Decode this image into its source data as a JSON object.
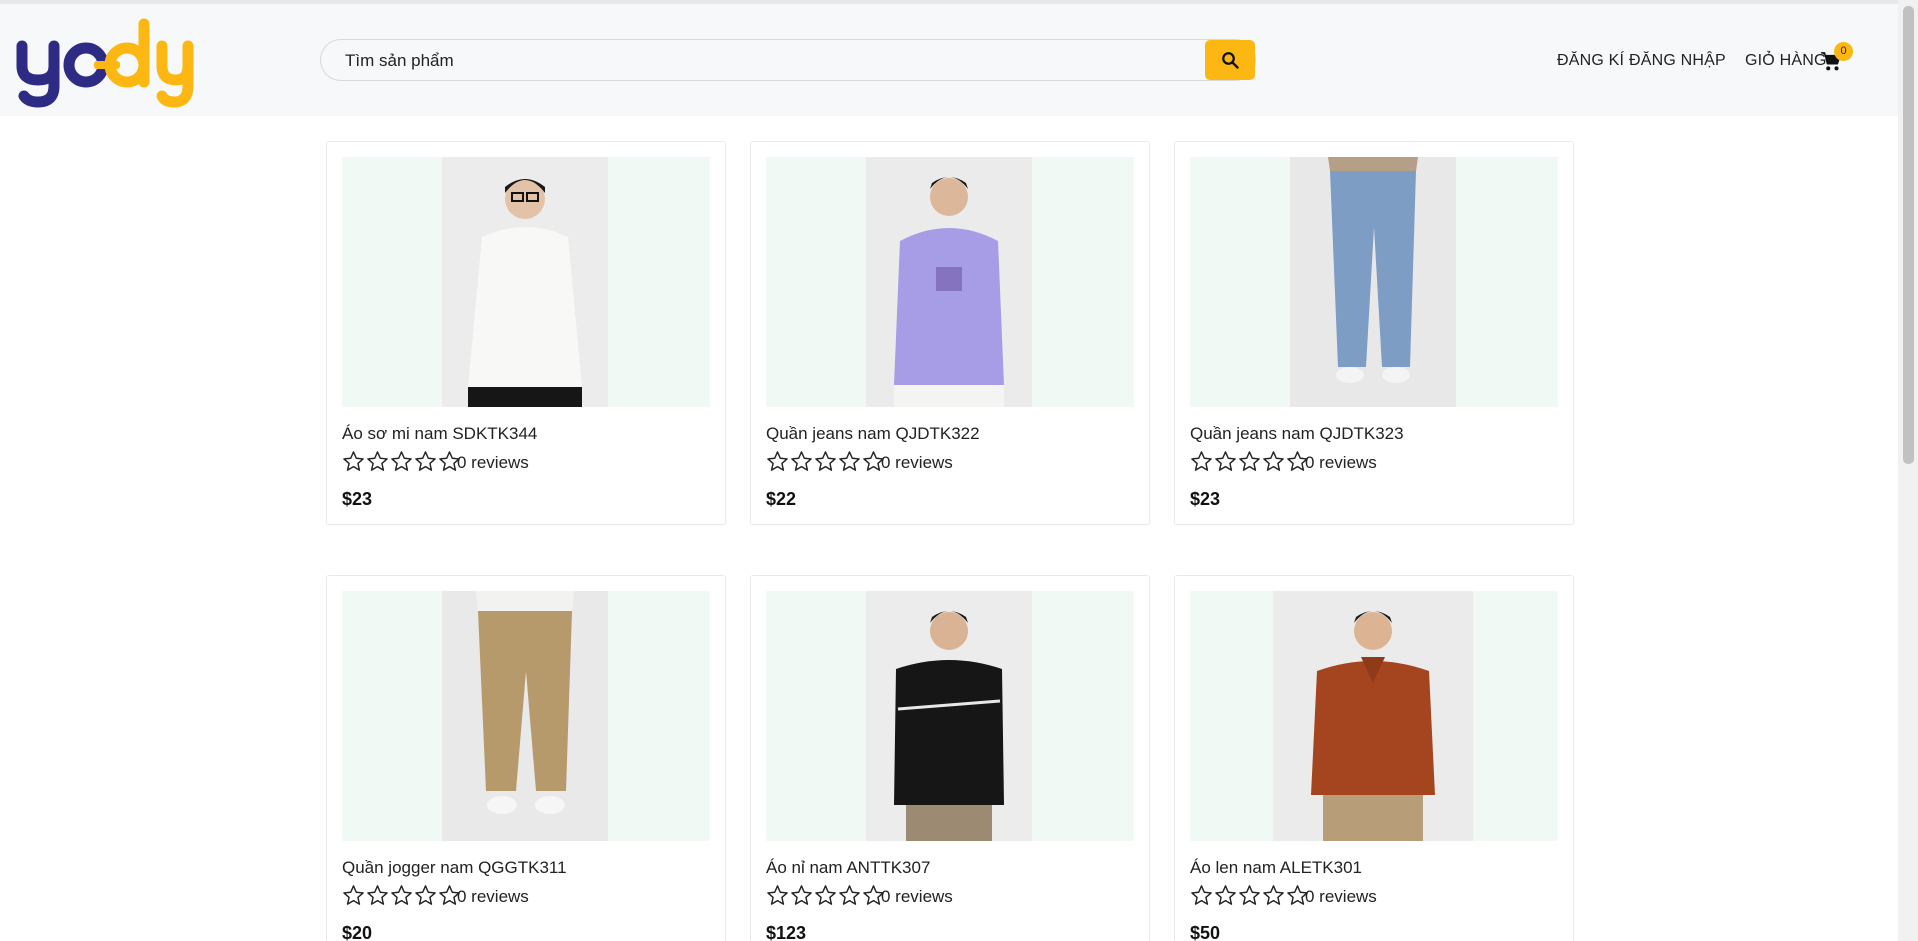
{
  "header": {
    "logo_text": "yody",
    "search_placeholder": "Tìm sản phẩm",
    "search_value": "",
    "register_label": "ĐĂNG KÍ",
    "login_label": "ĐĂNG NHẬP",
    "cart_label": "GIỎ HÀNG",
    "cart_count": "0"
  },
  "colors": {
    "brand_yellow": "#fcb713",
    "brand_navy": "#2e2b84",
    "image_bg": "#f1f9f4"
  },
  "products": [
    {
      "name": "Áo sơ mi nam SDKTK344",
      "reviews": "0 reviews",
      "price": "$23",
      "rating": 0,
      "photo": "white-shirt-man"
    },
    {
      "name": "Quần jeans nam QJDTK322",
      "reviews": "0 reviews",
      "price": "$22",
      "rating": 0,
      "photo": "lavender-hoodie-man"
    },
    {
      "name": "Quần jeans nam QJDTK323",
      "reviews": "0 reviews",
      "price": "$23",
      "rating": 0,
      "photo": "blue-jeans-legs"
    },
    {
      "name": "Quần jogger nam QGGTK311",
      "reviews": "0 reviews",
      "price": "$20",
      "rating": 0,
      "photo": "khaki-jogger-legs"
    },
    {
      "name": "Áo nỉ nam ANTTK307",
      "reviews": "0 reviews",
      "price": "$123",
      "rating": 0,
      "photo": "black-sweatshirt-man"
    },
    {
      "name": "Áo len nam ALETK301",
      "reviews": "0 reviews",
      "price": "$50",
      "rating": 0,
      "photo": "rust-polo-sweater-man"
    }
  ]
}
